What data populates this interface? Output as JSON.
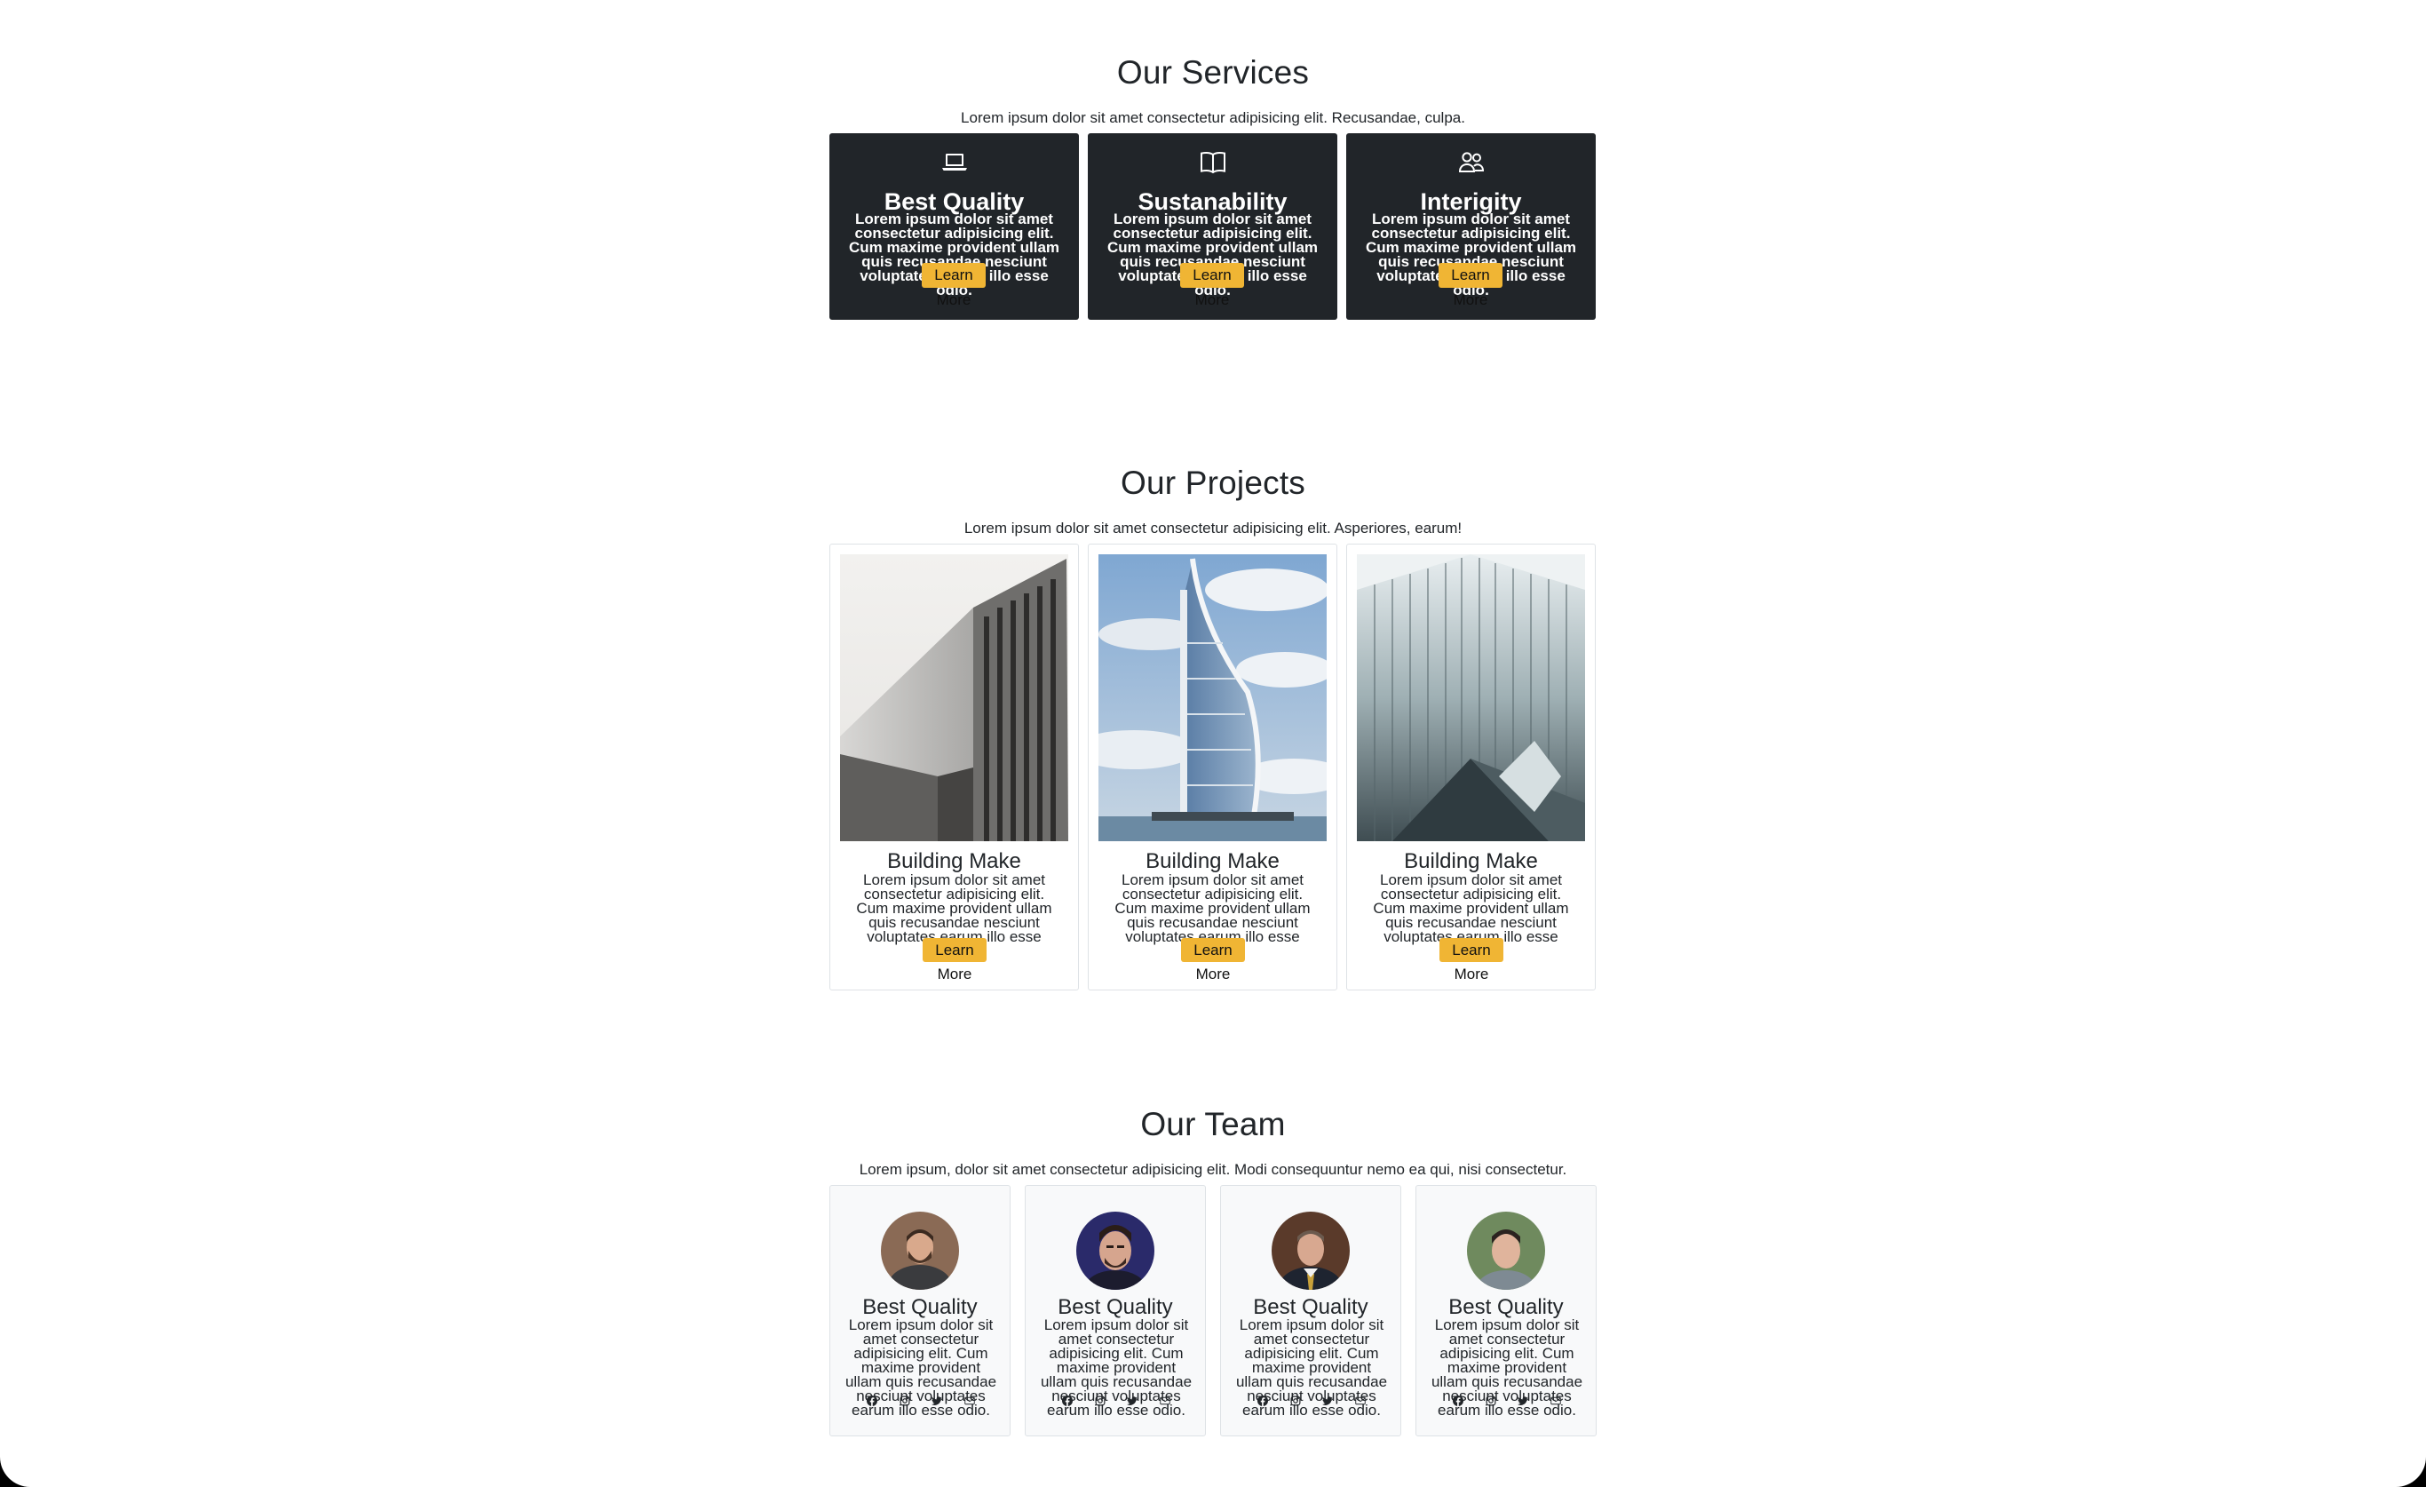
{
  "services": {
    "title": "Our Services",
    "subtitle": "Lorem ipsum dolor sit amet consectetur adipisicing elit. Recusandae, culpa.",
    "cards": [
      {
        "icon": "laptop-icon",
        "title": "Best Quality",
        "text": "Lorem ipsum dolor sit amet consectetur adipisicing elit. Cum maxime provident ullam quis recusandae nesciunt voluptates earum illo esse odio.",
        "button": "Learn More"
      },
      {
        "icon": "book-icon",
        "title": "Sustanability",
        "text": "Lorem ipsum dolor sit amet consectetur adipisicing elit. Cum maxime provident ullam quis recusandae nesciunt voluptates earum illo esse odio.",
        "button": "Learn More"
      },
      {
        "icon": "people-icon",
        "title": "Interigity",
        "text": "Lorem ipsum dolor sit amet consectetur adipisicing elit. Cum maxime provident ullam quis recusandae nesciunt voluptates earum illo esse odio.",
        "button": "Learn More"
      }
    ]
  },
  "projects": {
    "title": "Our Projects",
    "subtitle": "Lorem ipsum dolor sit amet consectetur adipisicing elit. Asperiores, earum!",
    "cards": [
      {
        "title": "Building Make",
        "text": "Lorem ipsum dolor sit amet consectetur adipisicing elit. Cum maxime provident ullam quis recusandae nesciunt voluptates earum illo esse odio.",
        "button": "Learn More"
      },
      {
        "title": "Building Make",
        "text": "Lorem ipsum dolor sit amet consectetur adipisicing elit. Cum maxime provident ullam quis recusandae nesciunt voluptates earum illo esse odio.",
        "button": "Learn More"
      },
      {
        "title": "Building Make",
        "text": "Lorem ipsum dolor sit amet consectetur adipisicing elit. Cum maxime provident ullam quis recusandae nesciunt voluptates earum illo esse odio.",
        "button": "Learn More"
      }
    ]
  },
  "team": {
    "title": "Our Team",
    "subtitle": "Lorem ipsum, dolor sit amet consectetur adipisicing elit. Modi consequuntur nemo ea qui, nisi consectetur.",
    "members": [
      {
        "name": "Best Quality",
        "text": "Lorem ipsum dolor sit amet consectetur adipisicing elit. Cum maxime provident ullam quis recusandae nesciunt voluptates earum illo esse odio."
      },
      {
        "name": "Best Quality",
        "text": "Lorem ipsum dolor sit amet consectetur adipisicing elit. Cum maxime provident ullam quis recusandae nesciunt voluptates earum illo esse odio."
      },
      {
        "name": "Best Quality",
        "text": "Lorem ipsum dolor sit amet consectetur adipisicing elit. Cum maxime provident ullam quis recusandae nesciunt voluptates earum illo esse odio."
      },
      {
        "name": "Best Quality",
        "text": "Lorem ipsum dolor sit amet consectetur adipisicing elit. Cum maxime provident ullam quis recusandae nesciunt voluptates earum illo esse odio."
      }
    ],
    "social_icons": [
      "facebook-icon",
      "instagram-icon",
      "twitter-icon",
      "email-icon"
    ]
  },
  "colors": {
    "dark_card": "#212529",
    "accent_button": "#f0b534",
    "team_card_bg": "#f8f9fa"
  }
}
